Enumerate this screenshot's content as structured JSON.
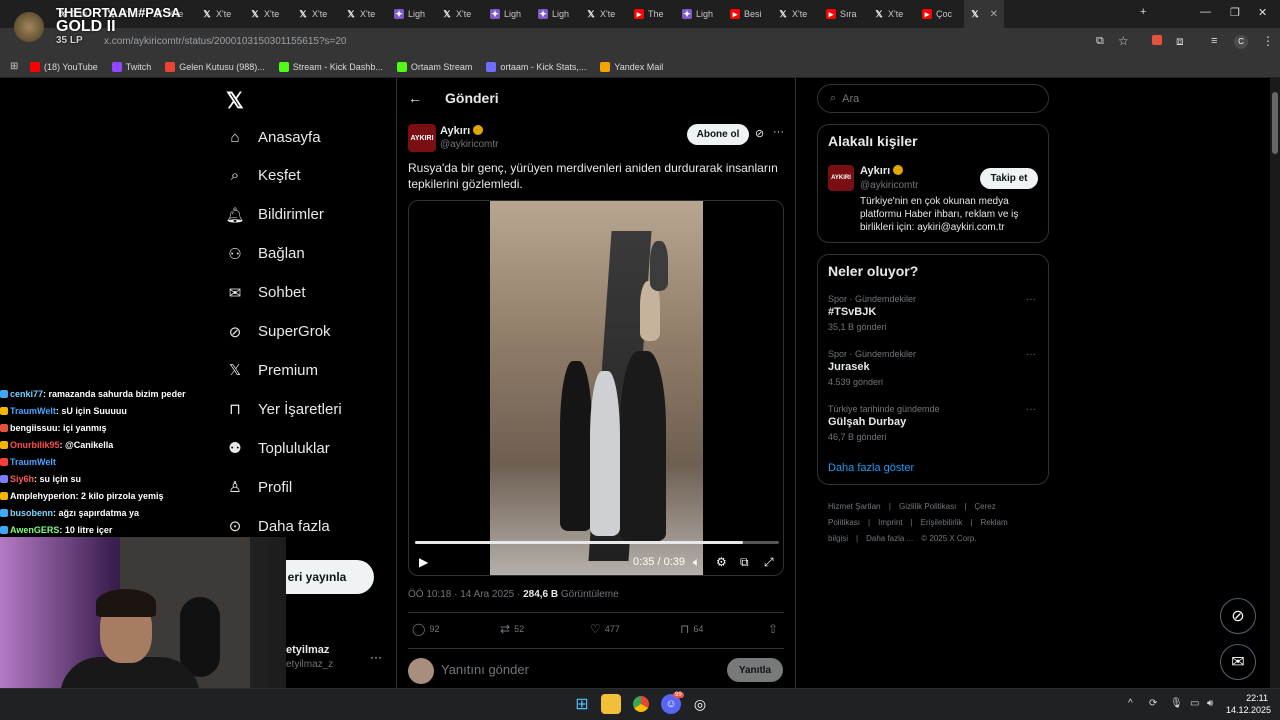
{
  "browser": {
    "tabs": [
      {
        "label": "X'te",
        "fav": "x"
      },
      {
        "label": "X'te",
        "fav": "x"
      },
      {
        "label": "X'te",
        "fav": "x"
      },
      {
        "label": "X'te",
        "fav": "x"
      },
      {
        "label": "X'te",
        "fav": "x"
      },
      {
        "label": "X'te",
        "fav": "x"
      },
      {
        "label": "X'te",
        "fav": "x"
      },
      {
        "label": "Ligh",
        "fav": "feather"
      },
      {
        "label": "X'te",
        "fav": "x"
      },
      {
        "label": "Ligh",
        "fav": "feather"
      },
      {
        "label": "Ligh",
        "fav": "feather"
      },
      {
        "label": "X'te",
        "fav": "x"
      },
      {
        "label": "The",
        "fav": "youtube"
      },
      {
        "label": "Ligh",
        "fav": "feather"
      },
      {
        "label": "Besi",
        "fav": "youtube"
      },
      {
        "label": "X'te",
        "fav": "x"
      },
      {
        "label": "Sıra",
        "fav": "youtube"
      },
      {
        "label": "X'te",
        "fav": "x"
      },
      {
        "label": "Çoc",
        "fav": "youtube"
      }
    ],
    "url": "x.com/aykiricomtr/status/2000103150301155615?s=20",
    "bookmarks": [
      {
        "label": "(18) YouTube",
        "color": "#ff0000"
      },
      {
        "label": "Twitch",
        "color": "#9146ff"
      },
      {
        "label": "Gelen Kutusu (988)...",
        "color": "#ea4335"
      },
      {
        "label": "Stream - Kick Dashb...",
        "color": "#53fc18"
      },
      {
        "label": "Ortaam Stream",
        "color": "#53fc18"
      },
      {
        "label": "ortaam - Kick Stats,...",
        "color": "#6f6fff"
      },
      {
        "label": "Yandex Mail",
        "color": "#f4a300"
      }
    ]
  },
  "overlay": {
    "rank_title": "THEORTAAM#PASA",
    "rank_tier": "GOLD II",
    "rank_lp": "35 LP"
  },
  "nav": {
    "items": [
      {
        "label": "Anasayfa",
        "icon": "home-icon"
      },
      {
        "label": "Keşfet",
        "icon": "search-icon"
      },
      {
        "label": "Bildirimler",
        "icon": "bell-icon"
      },
      {
        "label": "Bağlan",
        "icon": "add-person-icon"
      },
      {
        "label": "Sohbet",
        "icon": "mail-icon"
      },
      {
        "label": "SuperGrok",
        "icon": "grok-icon"
      },
      {
        "label": "Premium",
        "icon": "x-icon"
      },
      {
        "label": "Yer İşaretleri",
        "icon": "bookmark-icon"
      },
      {
        "label": "Topluluklar",
        "icon": "communities-icon"
      },
      {
        "label": "Profil",
        "icon": "profile-icon"
      },
      {
        "label": "Daha fazla",
        "icon": "more-circle-icon"
      }
    ],
    "post_button": "eri yayınla",
    "account_name": "etyilmaz",
    "account_handle": "etyilmaz_z"
  },
  "post": {
    "page_title": "Gönderi",
    "author_name": "Aykırı",
    "author_handle": "@aykiricomtr",
    "avatar_text": "AYKIRI",
    "subscribe": "Abone ol",
    "text": "Rusya'da bir genç, yürüyen merdivenleri aniden durdurarak insanların tepkilerini gözlemledi.",
    "video_time": "0:35 / 0:39",
    "video_progress": 0.9,
    "timestamp": "ÖÖ 10:18 · 14 Ara 2025 · ",
    "views": "284,6 B",
    "views_label": " Görüntüleme",
    "replies": "92",
    "reposts": "52",
    "likes": "477",
    "bookmarks": "64",
    "reply_placeholder": "Yanıtını gönder",
    "reply_button": "Yanıtla"
  },
  "sidebar": {
    "search_placeholder": "Ara",
    "related_title": "Alakalı kişiler",
    "related": {
      "name": "Aykırı",
      "handle": "@aykiricomtr",
      "follow": "Takip et",
      "bio": "Türkiye'nin en çok okunan medya platformu Haber ihbarı, reklam ve iş birlikleri için: aykiri@aykiri.com.tr"
    },
    "trends_title": "Neler oluyor?",
    "trends": [
      {
        "context": "Spor · Gündemdekiler",
        "name": "#TSvBJK",
        "count": "35,1 B gönderi"
      },
      {
        "context": "Spor · Gündemdekiler",
        "name": "Jurasek",
        "count": "4.539 gönderi"
      },
      {
        "context": "Türkiye tarihinde gündemde",
        "name": "Gülşah Durbay",
        "count": "46,7 B gönderi"
      }
    ],
    "show_more": "Daha fazla göster",
    "footer": [
      "Hizmet Şartları",
      "|",
      "Gizlilik Politikası",
      "|",
      "Çerez Politikası",
      "|",
      "Imprint",
      "|",
      "Erişilebilirlik",
      "|",
      "Reklam bilgisi",
      "|",
      "Daha fazla ...",
      "© 2025 X Corp."
    ]
  },
  "chat": [
    {
      "user": "cenki77",
      "color": "#6fd0ff",
      "msg": ": ramazanda sahurda bizim peder"
    },
    {
      "user": "TraumWelt",
      "color": "#4aa3ff",
      "msg": ": sU için Suuuuu"
    },
    {
      "user": "bengiissuu",
      "color": "#ffffff",
      "msg": ": içi yanmış"
    },
    {
      "user": "Onurbilik95",
      "color": "#ff4d4d",
      "msg": ": @Canikella"
    },
    {
      "user": "TraumWelt",
      "color": "#4aa3ff",
      "msg": ""
    },
    {
      "user": "Siy6h",
      "color": "#ff5b5b",
      "msg": ": su için su"
    },
    {
      "user": "Amplehyperion",
      "color": "#ffffff",
      "msg": ": 2 kilo pirzola yemiş"
    },
    {
      "user": "busobenn",
      "color": "#7fd6ff",
      "msg": ": ağzı şapırdatma ya"
    },
    {
      "user": "AwenGERS",
      "color": "#7fff7f",
      "msg": ": 10 litre içer"
    }
  ],
  "taskbar": {
    "time": "22:11",
    "date": "14.12.2025",
    "discord_badge": "99"
  }
}
